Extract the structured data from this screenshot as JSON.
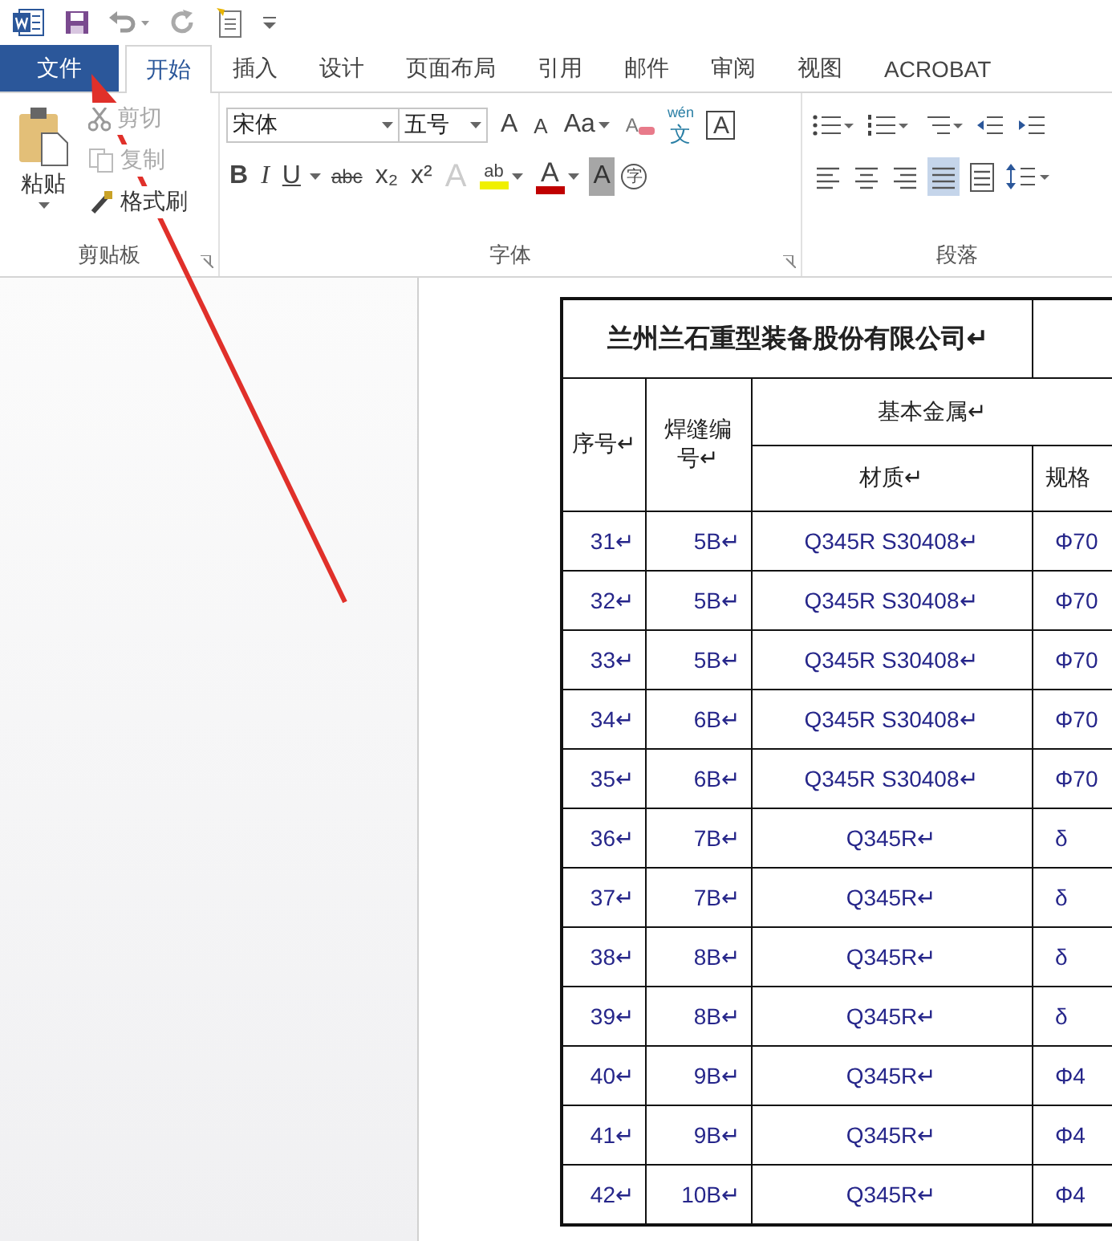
{
  "tabs": [
    {
      "label": "文件",
      "kind": "file",
      "selected": false
    },
    {
      "label": "开始",
      "kind": "tab",
      "selected": true
    },
    {
      "label": "插入",
      "kind": "tab",
      "selected": false
    },
    {
      "label": "设计",
      "kind": "tab",
      "selected": false
    },
    {
      "label": "页面布局",
      "kind": "tab",
      "selected": false
    },
    {
      "label": "引用",
      "kind": "tab",
      "selected": false
    },
    {
      "label": "邮件",
      "kind": "tab",
      "selected": false
    },
    {
      "label": "审阅",
      "kind": "tab",
      "selected": false
    },
    {
      "label": "视图",
      "kind": "tab",
      "selected": false
    },
    {
      "label": "ACROBAT",
      "kind": "tab",
      "selected": false
    }
  ],
  "clipboard": {
    "label": "剪贴板",
    "paste": "粘贴",
    "actions": [
      {
        "label": "剪切",
        "kind": "cut",
        "disabled": true
      },
      {
        "label": "复制",
        "kind": "copy",
        "disabled": true
      },
      {
        "label": "格式刷",
        "kind": "painter",
        "disabled": false
      }
    ]
  },
  "font": {
    "label": "字体",
    "font_name": "宋体",
    "font_size": "五号",
    "grow": "A",
    "shrink": "A",
    "change_case": "Aa",
    "pinyin_top": "wén",
    "pinyin_bottom": "文",
    "border_char": "A",
    "clear_char": "A",
    "styles": [
      {
        "label": "B",
        "kind": "bold"
      },
      {
        "label": "I",
        "kind": "italic"
      },
      {
        "label": "U",
        "kind": "underline"
      },
      {
        "label": "abc",
        "kind": "strike"
      },
      {
        "label": "x₂",
        "kind": "sub"
      },
      {
        "label": "x²",
        "kind": "sup"
      }
    ],
    "effects_char": "A",
    "highlight_char": "ab",
    "font_color_char": "A",
    "shading_char": "A",
    "enclose_char": "字"
  },
  "paragraph": {
    "label": "段落",
    "alignments": [
      {
        "kind": "left",
        "selected": false
      },
      {
        "kind": "center",
        "selected": false
      },
      {
        "kind": "right",
        "selected": false
      },
      {
        "kind": "justify",
        "selected": true
      },
      {
        "kind": "distribute",
        "selected": false
      }
    ]
  },
  "table": {
    "title": "兰州兰石重型装备股份有限公司↵",
    "col_seq": "序号↵",
    "col_weld": "焊缝编号↵",
    "col_base": "基本金属↵",
    "col_material": "材质↵",
    "col_spec": "规格",
    "rows": [
      [
        "31↵",
        "5B↵",
        "Q345R S30408↵",
        "Φ70"
      ],
      [
        "32↵",
        "5B↵",
        "Q345R S30408↵",
        "Φ70"
      ],
      [
        "33↵",
        "5B↵",
        "Q345R S30408↵",
        "Φ70"
      ],
      [
        "34↵",
        "6B↵",
        "Q345R S30408↵",
        "Φ70"
      ],
      [
        "35↵",
        "6B↵",
        "Q345R S30408↵",
        "Φ70"
      ],
      [
        "36↵",
        "7B↵",
        "Q345R↵",
        "δ"
      ],
      [
        "37↵",
        "7B↵",
        "Q345R↵",
        "δ"
      ],
      [
        "38↵",
        "8B↵",
        "Q345R↵",
        "δ"
      ],
      [
        "39↵",
        "8B↵",
        "Q345R↵",
        "δ"
      ],
      [
        "40↵",
        "9B↵",
        "Q345R↵",
        "Φ4"
      ],
      [
        "41↵",
        "9B↵",
        "Q345R↵",
        "Φ4"
      ],
      [
        "42↵",
        "10B↵",
        "Q345R↵",
        "Φ4"
      ]
    ]
  }
}
